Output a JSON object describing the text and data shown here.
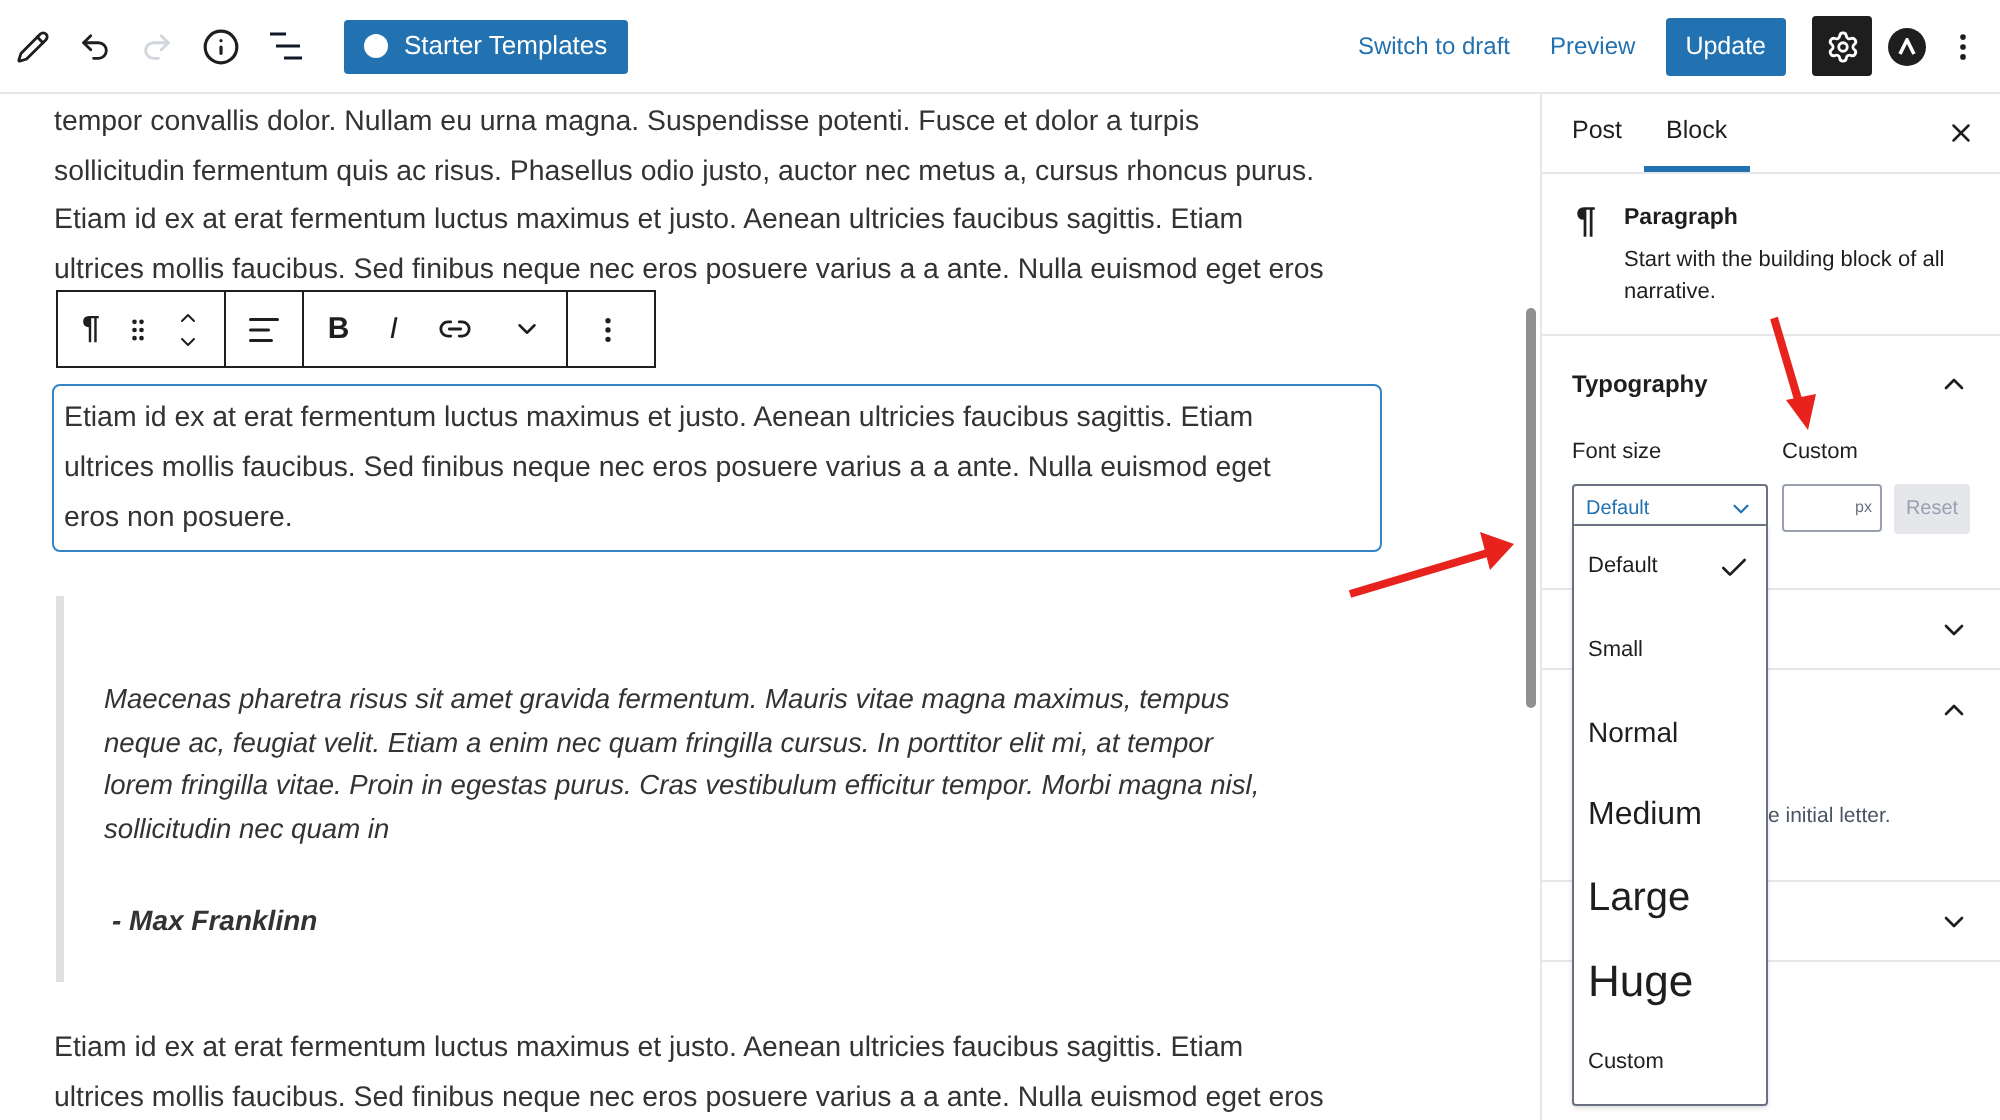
{
  "header": {
    "starter_button": "Starter Templates",
    "switch_link": "Switch to draft",
    "preview_link": "Preview",
    "update_button": "Update",
    "settings_active": true
  },
  "editor": {
    "paragraphs_before": [
      {
        "lines": [
          "tempor convallis dolor. Nullam eu urna magna. Suspendisse potenti. Fusce et dolor a turpis",
          "sollicitudin fermentum quis ac risus. Phasellus odio justo, auctor nec metus a, cursus rhoncus purus.",
          "Etiam id ex at erat fermentum luctus maximus et justo. Aenean ultricies faucibus sagittis. Etiam",
          "ultrices mollis faucibus. Sed finibus neque nec eros posuere varius a a ante. Nulla euismod eget eros"
        ]
      }
    ],
    "block_toolbar": {
      "paragraph_glyph": "¶",
      "bold_glyph": "B",
      "italic_glyph": "I"
    },
    "selected_paragraph": {
      "lines": [
        "Etiam id ex at erat fermentum luctus maximus et justo. Aenean ultricies faucibus sagittis. Etiam",
        "ultrices mollis faucibus. Sed finibus neque nec eros posuere varius a a ante. Nulla euismod eget",
        "eros non posuere."
      ]
    },
    "quote": {
      "lines": [
        "Maecenas pharetra risus sit amet gravida fermentum. Mauris vitae magna maximus, tempus",
        "neque ac, feugiat velit. Etiam a enim nec quam fringilla cursus. In porttitor elit mi, at tempor",
        "lorem fringilla vitae. Proin in egestas purus. Cras vestibulum efficitur tempor. Morbi magna nisl,",
        "sollicitudin nec quam in"
      ],
      "citation": "- Max Franklinn"
    },
    "paragraphs_after": [
      {
        "lines": [
          "Etiam id ex at erat fermentum luctus maximus et justo. Aenean ultricies faucibus sagittis. Etiam",
          "ultrices mollis faucibus. Sed finibus neque nec eros posuere varius a a ante. Nulla euismod eget eros"
        ]
      }
    ]
  },
  "sidebar": {
    "tabs": [
      {
        "label": "Post",
        "selected": false
      },
      {
        "label": "Block",
        "selected": true
      }
    ],
    "block_card": {
      "glyph": "¶",
      "title": "Paragraph",
      "description": "Start with the building block of all narrative."
    },
    "typography": {
      "title": "Typography",
      "expanded": true,
      "font_size_label": "Font size",
      "custom_label": "Custom",
      "select_value": "Default",
      "unit": "px",
      "reset_button": "Reset"
    },
    "panels": [
      {
        "expanded": false
      },
      {
        "expanded": true,
        "partial_text": "e initial letter."
      },
      {
        "expanded": false
      }
    ],
    "dropdown": {
      "options": [
        {
          "label": "Default",
          "selected": true,
          "kind": "default"
        },
        {
          "label": "Small",
          "selected": false,
          "kind": "small"
        },
        {
          "label": "Normal",
          "selected": false,
          "kind": "normal"
        },
        {
          "label": "Medium",
          "selected": false,
          "kind": "medium"
        },
        {
          "label": "Large",
          "selected": false,
          "kind": "large"
        },
        {
          "label": "Huge",
          "selected": false,
          "kind": "huge"
        },
        {
          "label": "Custom",
          "selected": false,
          "kind": "custom"
        }
      ]
    }
  }
}
